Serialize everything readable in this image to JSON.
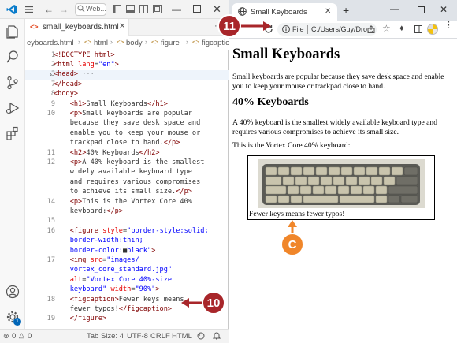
{
  "vscode": {
    "titlebar": {
      "search_text": "Web..."
    },
    "tab": {
      "label": "small_keyboards.html"
    },
    "breadcrumb": [
      "eyboards.html",
      "html",
      "body",
      "figure",
      "figcaption"
    ],
    "lines": [
      {
        "n": "1",
        "parts": [
          [
            "tg",
            "<!DOCTYPE html>"
          ]
        ]
      },
      {
        "n": "2",
        "parts": [
          [
            "tg",
            "<html "
          ],
          [
            "at",
            "lang"
          ],
          [
            "tx",
            "="
          ],
          [
            "st",
            "\"en\""
          ],
          [
            "tg",
            ">"
          ]
        ]
      },
      {
        "n": "3",
        "parts": [
          [
            "tg",
            "<head>"
          ],
          [
            "tx",
            " ···"
          ]
        ]
      },
      {
        "n": "7",
        "parts": [
          [
            "tg",
            "</head>"
          ]
        ]
      },
      {
        "n": "8",
        "parts": [
          [
            "tg",
            "<body>"
          ]
        ]
      },
      {
        "n": "9",
        "parts": [
          [
            "tx",
            "    "
          ],
          [
            "tg",
            "<h1>"
          ],
          [
            "tx",
            "Small Keyboards"
          ],
          [
            "tg",
            "</h1>"
          ]
        ]
      },
      {
        "n": "10",
        "parts": [
          [
            "tx",
            "    "
          ],
          [
            "tg",
            "<p>"
          ],
          [
            "tx",
            "Small keyboards are popular"
          ]
        ]
      },
      {
        "n": "",
        "parts": [
          [
            "tx",
            "    because they save desk space and"
          ]
        ]
      },
      {
        "n": "",
        "parts": [
          [
            "tx",
            "    enable you to keep your mouse or"
          ]
        ]
      },
      {
        "n": "",
        "parts": [
          [
            "tx",
            "    trackpad close to hand."
          ],
          [
            "tg",
            "</p>"
          ]
        ]
      },
      {
        "n": "11",
        "parts": [
          [
            "tx",
            "    "
          ],
          [
            "tg",
            "<h2>"
          ],
          [
            "tx",
            "40% Keyboards"
          ],
          [
            "tg",
            "</h2>"
          ]
        ]
      },
      {
        "n": "12",
        "parts": [
          [
            "tx",
            "    "
          ],
          [
            "tg",
            "<p>"
          ],
          [
            "tx",
            "A 40% keyboard is the smallest"
          ]
        ]
      },
      {
        "n": "",
        "parts": [
          [
            "tx",
            "    widely available keyboard type"
          ]
        ]
      },
      {
        "n": "",
        "parts": [
          [
            "tx",
            "    and requires various compromises"
          ]
        ]
      },
      {
        "n": "",
        "parts": [
          [
            "tx",
            "    to achieve its small size."
          ],
          [
            "tg",
            "</p>"
          ]
        ]
      },
      {
        "n": "14",
        "parts": [
          [
            "tx",
            "    "
          ],
          [
            "tg",
            "<p>"
          ],
          [
            "tx",
            "This is the Vortex Core 40%"
          ]
        ]
      },
      {
        "n": "",
        "parts": [
          [
            "tx",
            "    keyboard:"
          ],
          [
            "tg",
            "</p>"
          ]
        ]
      },
      {
        "n": "15",
        "parts": []
      },
      {
        "n": "16",
        "parts": [
          [
            "tx",
            "    "
          ],
          [
            "tg",
            "<figure "
          ],
          [
            "at",
            "style"
          ],
          [
            "tx",
            "="
          ],
          [
            "st",
            "\"border-style:solid;"
          ]
        ]
      },
      {
        "n": "",
        "parts": [
          [
            "st",
            "    border-width:thin;"
          ]
        ]
      },
      {
        "n": "",
        "parts": [
          [
            "st",
            "    border-color:"
          ],
          [
            "tx",
            "■"
          ],
          [
            "st",
            "black\""
          ],
          [
            "tg",
            ">"
          ]
        ]
      },
      {
        "n": "17",
        "parts": [
          [
            "tx",
            "    "
          ],
          [
            "tg",
            "<img "
          ],
          [
            "at",
            "src"
          ],
          [
            "tx",
            "="
          ],
          [
            "st",
            "\"images/"
          ]
        ]
      },
      {
        "n": "",
        "parts": [
          [
            "st",
            "    vortex_core_standard.jpg\""
          ]
        ]
      },
      {
        "n": "",
        "parts": [
          [
            "tx",
            "    "
          ],
          [
            "at",
            "alt"
          ],
          [
            "tx",
            "="
          ],
          [
            "st",
            "\"Vortex Core 40%-size"
          ]
        ]
      },
      {
        "n": "",
        "parts": [
          [
            "st",
            "    keyboard\" "
          ],
          [
            "at",
            "width"
          ],
          [
            "tx",
            "="
          ],
          [
            "st",
            "\"90%\""
          ],
          [
            "tg",
            ">"
          ]
        ]
      },
      {
        "n": "18",
        "parts": [
          [
            "tx",
            "    "
          ],
          [
            "tg",
            "<figcaption>"
          ],
          [
            "tx",
            "Fewer keys means"
          ]
        ]
      },
      {
        "n": "",
        "parts": [
          [
            "tx",
            "    fewer typos!"
          ],
          [
            "tg",
            "</figcaption>"
          ]
        ]
      },
      {
        "n": "19",
        "parts": [
          [
            "tx",
            "    "
          ],
          [
            "tg",
            "</figure>"
          ]
        ]
      }
    ],
    "status": {
      "errors": "0",
      "warnings": "0",
      "tab_size": "Tab Size: 4",
      "encoding": "UTF-8",
      "eol": "CRLF",
      "language": "HTML"
    },
    "account_badge": "1"
  },
  "browser": {
    "tab_title": "Small Keyboards",
    "address": "C:/Users/Guy/Dro...",
    "file_label": "File",
    "page": {
      "h1": "Small Keyboards",
      "p1": "Small keyboards are popular because they save desk space and enable you to keep your mouse or trackpad close to hand.",
      "h2": "40% Keyboards",
      "p2": "A 40% keyboard is the smallest widely available keyboard type and requires various compromises to achieve its small size.",
      "p3": "This is the Vortex Core 40% keyboard:",
      "figcaption": "Fewer keys means fewer typos!"
    }
  },
  "callouts": {
    "c11": "11",
    "c10": "10",
    "cC": "C"
  },
  "colors": {
    "callout_red": "#a8262a",
    "callout_orange": "#f0862a",
    "vscode_blue": "#0066b8"
  }
}
